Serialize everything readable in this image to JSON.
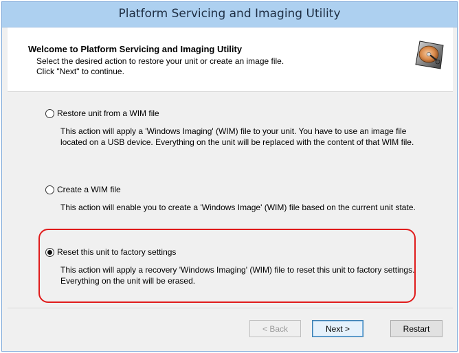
{
  "window": {
    "title": "Platform Servicing and Imaging Utility"
  },
  "header": {
    "title": "Welcome to Platform Servicing and Imaging Utility",
    "line1": "Select the desired action to restore your unit or create an image file.",
    "line2": "Click \"Next\" to continue.",
    "icon": "hard-disk-icon"
  },
  "options": [
    {
      "label": "Restore unit from a WIM file",
      "selected": false,
      "description": "This action will apply a 'Windows Imaging' (WIM) file to your unit. You have to use an image file located on a USB device. Everything on the unit will be replaced with the content of that WIM file."
    },
    {
      "label": "Create a WIM file",
      "selected": false,
      "description": "This action will enable you to create a 'Windows Image' (WIM) file based on the current unit state."
    },
    {
      "label": "Reset this unit to factory settings",
      "selected": true,
      "description": "This action will apply a recovery 'Windows Imaging' (WIM) file to reset this unit to factory settings. Everything on the unit will be erased."
    }
  ],
  "buttons": {
    "back": "< Back",
    "next": "Next >",
    "restart": "Restart"
  },
  "colors": {
    "titlebar": "#add0f0",
    "highlight": "#e01b1b",
    "default_button_border": "#3c7fb1"
  }
}
